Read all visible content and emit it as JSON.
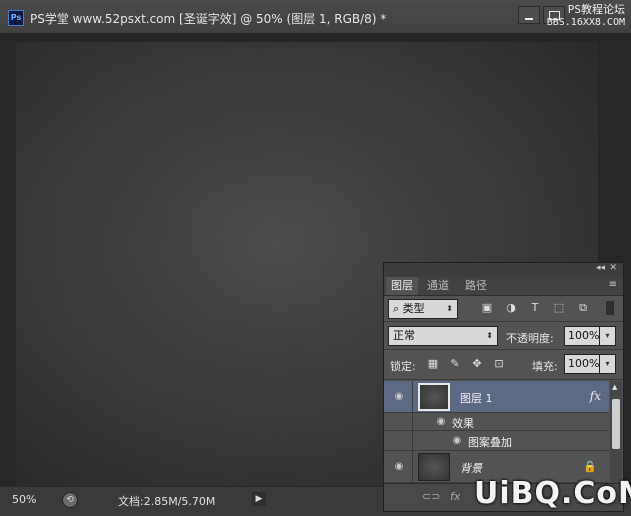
{
  "window": {
    "title": "PS学堂 www.52psxt.com [圣诞字效] @ 50% (图层 1, RGB/8) *",
    "app_logo": "Ps"
  },
  "watermark_top": {
    "line1": "PS教程论坛",
    "line2": "BBS.16XX8.COM"
  },
  "status": {
    "zoom": "50%",
    "doc_size": "文档:2.85M/5.70M"
  },
  "layers_panel": {
    "tabs": [
      "图层",
      "通道",
      "路径"
    ],
    "filter": {
      "kind_label": "类型"
    },
    "blend_mode": "正常",
    "opacity_label": "不透明度:",
    "opacity_value": "100%",
    "lock_label": "锁定:",
    "fill_label": "填充:",
    "fill_value": "100%",
    "layers": [
      {
        "name": "图层 1",
        "fx": "fx",
        "selected": true
      },
      {
        "name": "效果"
      },
      {
        "name": "图案叠加"
      },
      {
        "name": "背景",
        "locked": true
      }
    ]
  },
  "watermark_bottom": "UiBQ.CoM",
  "colors": {
    "selected_layer": "#5b6a82",
    "panel_bg": "#535353",
    "canvas_bg": "#262626"
  }
}
